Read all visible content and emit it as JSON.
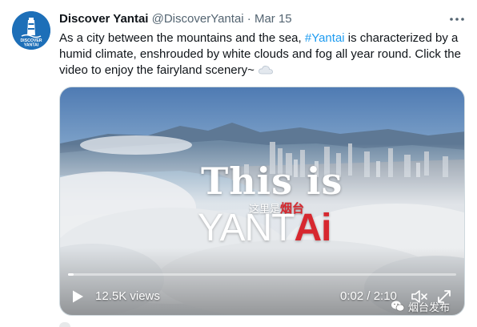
{
  "tweet": {
    "author_name": "Discover Yantai",
    "author_handle": "@DiscoverYantai",
    "separator": "·",
    "date": "Mar 15",
    "text_before_hashtag": "As a city between the mountains and the sea, ",
    "hashtag": "#Yantai",
    "text_after_hashtag": " is characterized by a humid climate, enshrouded by white clouds and fog all year round. Click the video to enjoy the fairyland scenery~",
    "avatar_text_line1": "DISCOVER",
    "avatar_text_line2": "YANTAI"
  },
  "video": {
    "overlay_title": "This is",
    "overlay_chinese_prefix": "这里是",
    "overlay_chinese_red": "烟台",
    "overlay_brand_main": "YANT",
    "overlay_brand_accent": "Ai",
    "views_label": "12.5K views",
    "time_label": "0:02 / 2:10",
    "progress_fraction": 0.015,
    "watermark_text": "烟台发布"
  },
  "colors": {
    "accent": "#1d9bf0",
    "brand_red": "#d7282f",
    "avatar_bg": "#1d6fb8"
  },
  "icons": [
    "more-icon",
    "cloud-icon",
    "play-icon",
    "volume-icon",
    "fullscreen-icon",
    "wechat-icon",
    "lighthouse-icon"
  ]
}
